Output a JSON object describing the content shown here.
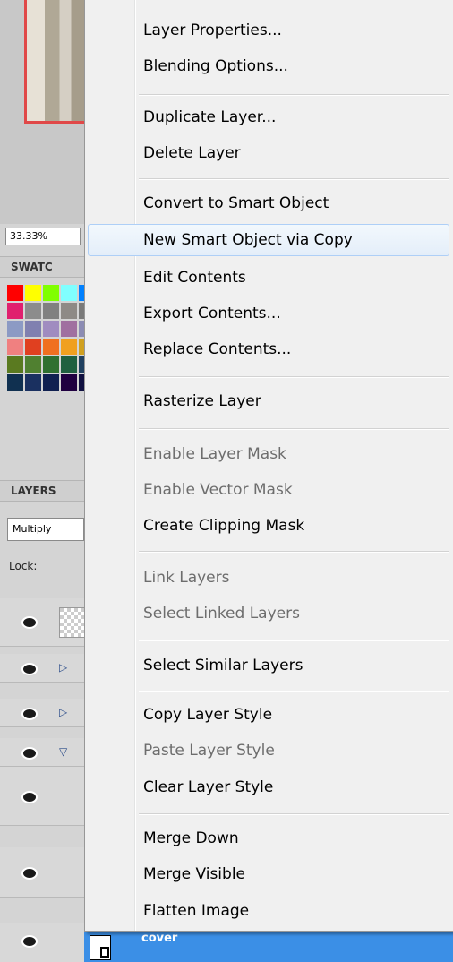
{
  "panels": {
    "zoom": "33.33%",
    "swatches_title": "SWATC",
    "layers_title": "LAYERS",
    "blend_mode": "Multiply",
    "lock_label": "Lock:",
    "selected_layer": "cover",
    "swatch_colors": [
      "#ff0000",
      "#ffff00",
      "#80ff00",
      "#80ffff",
      "#0080ff",
      "#e0206e",
      "#8c8c8c",
      "#808080",
      "#8e8a86",
      "#7a7a7a",
      "#8c9ac4",
      "#8080b0",
      "#a08cc0",
      "#a070a0",
      "#8c8cb4",
      "#f08080",
      "#e04020",
      "#f07020",
      "#f0a020",
      "#d0a020",
      "#5a7a20",
      "#508030",
      "#307030",
      "#206040",
      "#204060",
      "#103050",
      "#1a3060",
      "#102050",
      "#200040",
      "#101040"
    ]
  },
  "menu": {
    "items": [
      {
        "label": "Layer Properties...",
        "enabled": true
      },
      {
        "label": "Blending Options...",
        "enabled": true
      },
      {
        "label": "Duplicate Layer...",
        "enabled": true
      },
      {
        "label": "Delete Layer",
        "enabled": true
      },
      {
        "label": "Convert to Smart Object",
        "enabled": true
      },
      {
        "label": "New Smart Object via Copy",
        "enabled": true,
        "highlighted": true
      },
      {
        "label": "Edit Contents",
        "enabled": true
      },
      {
        "label": "Export Contents...",
        "enabled": true
      },
      {
        "label": "Replace Contents...",
        "enabled": true
      },
      {
        "label": "Rasterize Layer",
        "enabled": true
      },
      {
        "label": "Enable Layer Mask",
        "enabled": false
      },
      {
        "label": "Enable Vector Mask",
        "enabled": false
      },
      {
        "label": "Create Clipping Mask",
        "enabled": true
      },
      {
        "label": "Link Layers",
        "enabled": false
      },
      {
        "label": "Select Linked Layers",
        "enabled": false
      },
      {
        "label": "Select Similar Layers",
        "enabled": true
      },
      {
        "label": "Copy Layer Style",
        "enabled": true
      },
      {
        "label": "Paste Layer Style",
        "enabled": false
      },
      {
        "label": "Clear Layer Style",
        "enabled": true
      },
      {
        "label": "Merge Down",
        "enabled": true
      },
      {
        "label": "Merge Visible",
        "enabled": true
      },
      {
        "label": "Flatten Image",
        "enabled": true
      }
    ]
  }
}
